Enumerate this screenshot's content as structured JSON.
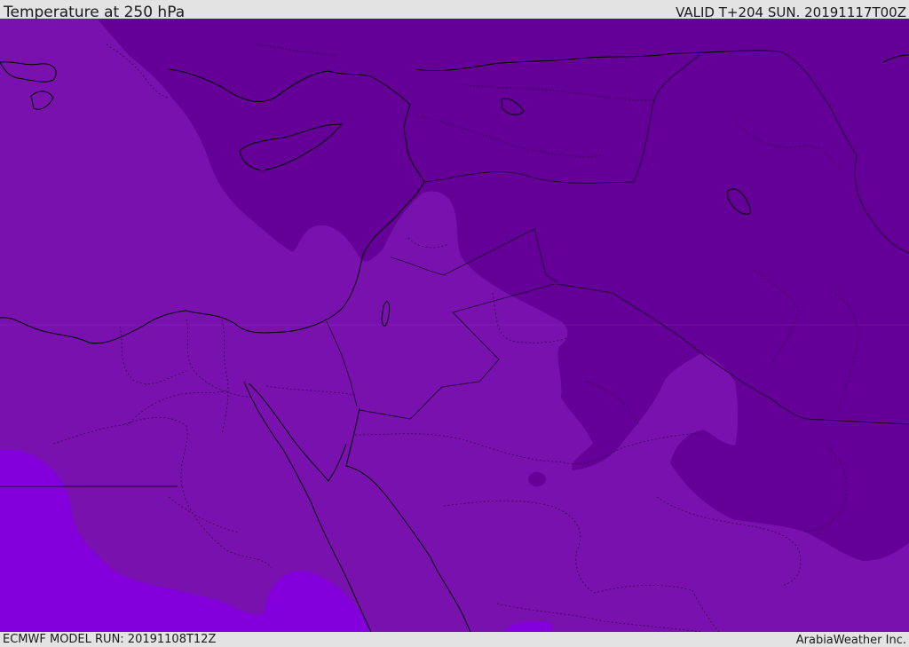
{
  "header": {
    "title": "Temperature at 250 hPa",
    "valid_time": "VALID T+204 SUN. 20191117T00Z"
  },
  "footer": {
    "model_run": "ECMWF MODEL RUN: 20191108T12Z",
    "credit": "ArabiaWeather Inc."
  },
  "map": {
    "field": "temperature-250hPa",
    "colors": {
      "cold_band": "#640097",
      "mid_band": "#7911af",
      "warm_band": "#8300dd",
      "coastline": "#000000",
      "internal_border": "#1f0030"
    }
  }
}
